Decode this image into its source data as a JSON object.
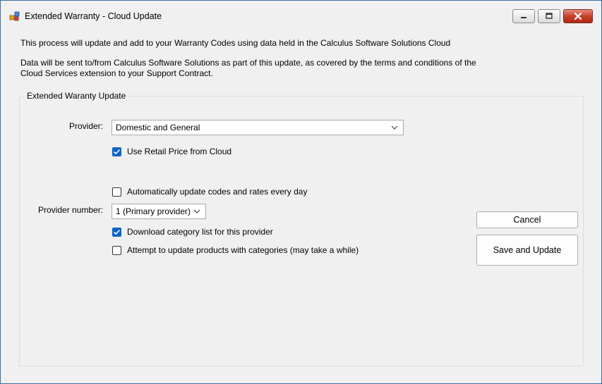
{
  "window": {
    "title": "Extended Warranty - Cloud Update",
    "icon": "app-icon",
    "controls": [
      "minimize-icon",
      "maximize-icon",
      "close-icon"
    ]
  },
  "info": {
    "line1": "This process will update and add to your Warranty Codes using data held in the Calculus Software Solutions Cloud",
    "line2": "Data will be sent to/from Calculus Software Solutions as part of this update, as covered by the terms and conditions of the",
    "line3": "Cloud Services extension to your Support Contract."
  },
  "group": {
    "title": "Extended Waranty Update",
    "provider_label": "Provider:",
    "provider_value": "Domestic and General",
    "use_retail_price": {
      "label": "Use Retail Price from Cloud",
      "checked": true
    },
    "auto_update": {
      "label": "Automatically update codes and rates every day",
      "checked": false
    },
    "provider_number_label": "Provider number:",
    "provider_number_value": "1 (Primary provider)",
    "download_category": {
      "label": "Download category list for this provider",
      "checked": true
    },
    "update_products": {
      "label": "Attempt to update products with categories (may take a while)",
      "checked": false
    }
  },
  "buttons": {
    "cancel": "Cancel",
    "save_update": "Save and Update"
  },
  "colors": {
    "accent": "#0d63c6",
    "background": "#f0f0f0"
  }
}
